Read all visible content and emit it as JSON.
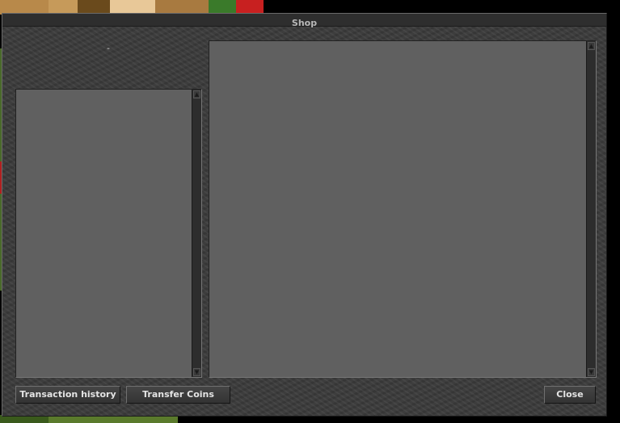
{
  "window": {
    "title": "Shop",
    "status_text": "-"
  },
  "buttons": {
    "transaction_history": "Transaction history",
    "transfer_coins": "Transfer Coins",
    "close": "Close"
  },
  "colors": {
    "window_bg": "#3b3b3b",
    "panel_bg": "#606060",
    "text": "#e4e4e4",
    "title_text": "#b8b8b8"
  },
  "icons": {
    "scroll_up": "triangle-up-icon",
    "scroll_down": "triangle-down-icon"
  }
}
